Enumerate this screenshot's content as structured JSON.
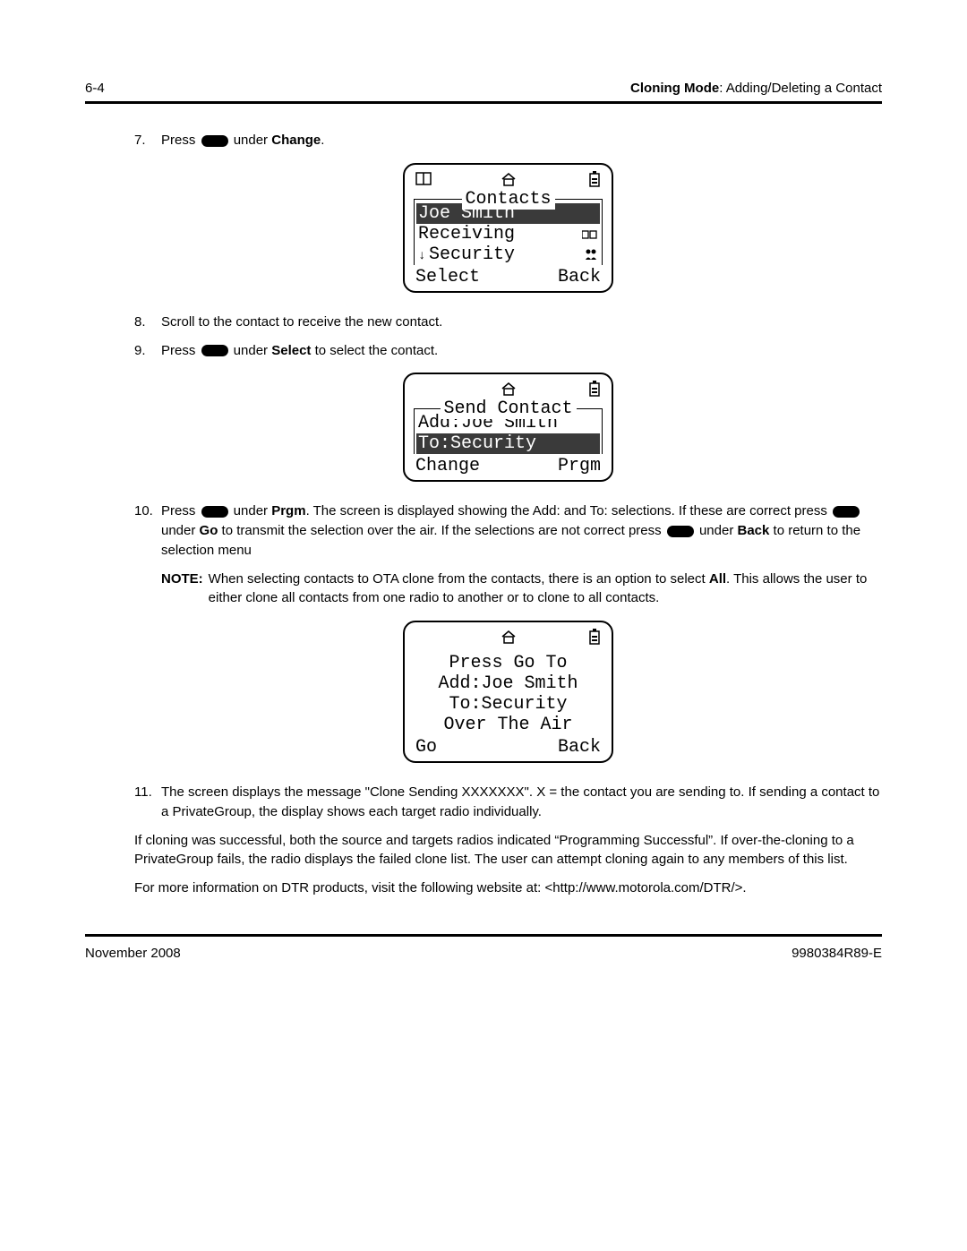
{
  "header": {
    "page_num": "6-4",
    "section_bold": "Cloning Mode",
    "section_rest": ": Adding/Deleting a Contact"
  },
  "steps": {
    "s7": {
      "num": "7.",
      "a": "Press",
      "b": " under ",
      "c": "Change",
      "d": "."
    },
    "s8": {
      "num": "8.",
      "text": "Scroll to the contact to receive the new contact."
    },
    "s9": {
      "num": "9.",
      "a": "Press ",
      "b": " under ",
      "c": "Select",
      "d": " to select the contact."
    },
    "s10": {
      "num": "10.",
      "a": "Press ",
      "b": " under ",
      "c": "Prgm",
      "d": ". The screen is displayed showing the Add: and To: selections. If these are correct press ",
      "e": " under ",
      "f": "Go",
      "g": " to transmit the selection over the air. If the selections are not correct press",
      "h": " under ",
      "i": "Back",
      "j": " to return to the selection menu"
    },
    "s11": {
      "num": "11.",
      "text": "The screen displays the message \"Clone Sending XXXXXXX\". X = the contact you are sending to. If sending a contact to a PrivateGroup, the display shows each target radio individually."
    }
  },
  "note": {
    "label": "NOTE:",
    "a": "When selecting contacts to OTA clone from the contacts, there is an option to select ",
    "b": "All",
    "c": ". This allows the user to either clone all contacts from one radio to another or to clone to all contacts."
  },
  "screen1": {
    "title": "Contacts",
    "r1": "Joe Smith",
    "r2": "Receiving",
    "r3": "Security",
    "sk_left": "Select",
    "sk_right": "Back"
  },
  "screen2": {
    "title": "Send Contact",
    "r1": "Add:Joe Smith",
    "r2": "To:Security",
    "sk_left": "Change",
    "sk_right": "Prgm"
  },
  "screen3": {
    "l1": "Press Go To",
    "l2": "Add:Joe Smith",
    "l3": "To:Security",
    "l4": "Over The Air",
    "sk_left": "Go",
    "sk_right": "Back"
  },
  "para1": "If cloning was successful, both the source and targets radios indicated “Programming Successful”. If over-the-cloning to a PrivateGroup fails, the radio displays the failed clone list. The user can attempt cloning again to any members of this list.",
  "para2": "For more information on DTR products, visit the following website at: <http://www.motorola.com/DTR/>.",
  "footer": {
    "left": "November 2008",
    "right": "9980384R89-E"
  }
}
